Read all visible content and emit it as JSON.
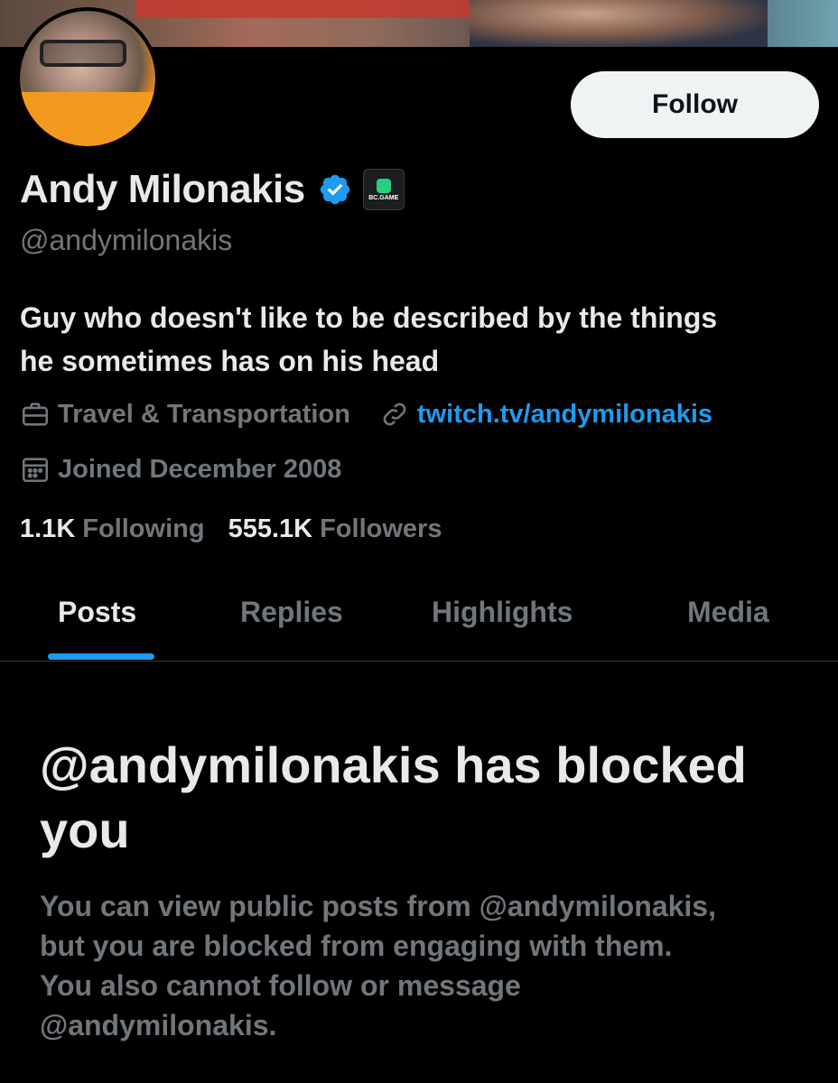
{
  "profile": {
    "name": "Andy Milonakis",
    "handle": "@andymilonakis",
    "affiliate_label": "BC.GAME",
    "bio_line1": "Guy who doesn't like to be described by the things",
    "bio_line2": "he sometimes has on his head",
    "category": "Travel & Transportation",
    "website": "twitch.tv/andymilonakis",
    "joined": "Joined December 2008",
    "following_count": "1.1K",
    "following_label": "Following",
    "followers_count": "555.1K",
    "followers_label": "Followers"
  },
  "actions": {
    "follow_label": "Follow"
  },
  "tabs": [
    {
      "label": "Posts",
      "active": true
    },
    {
      "label": "Replies",
      "active": false
    },
    {
      "label": "Highlights",
      "active": false
    },
    {
      "label": "Media",
      "active": false
    }
  ],
  "blocked": {
    "title_line1": "@andymilonakis has blocked",
    "title_line2": "you",
    "desc_line1": "You can view public posts from @andymilonakis,",
    "desc_line2": "but you are blocked from engaging with them.",
    "desc_line3": "You also cannot follow or message",
    "desc_line4": "@andymilonakis."
  },
  "icons": {
    "verified": "verified-badge-icon",
    "category": "briefcase-icon",
    "link": "link-icon",
    "calendar": "calendar-icon"
  },
  "colors": {
    "background": "#000000",
    "primary_text": "#e7e9ea",
    "secondary_text": "#71767b",
    "accent": "#1d9bf0",
    "follow_button_bg": "#eff3f4"
  }
}
